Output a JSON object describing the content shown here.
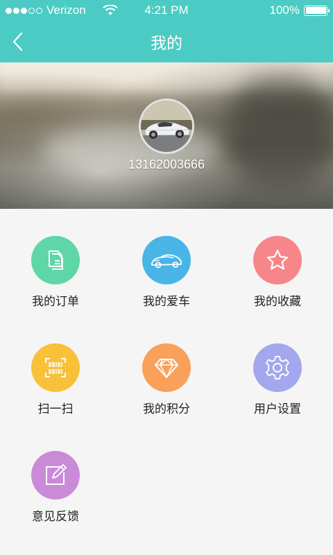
{
  "status_bar": {
    "carrier": "Verizon",
    "time": "4:21 PM",
    "battery": "100%",
    "battery_level": 1.0
  },
  "nav": {
    "title": "我的",
    "back_icon": "chevron-left-icon"
  },
  "profile": {
    "phone": "13162003666",
    "avatar_icon": "car-photo"
  },
  "menu": [
    {
      "label": "我的订单",
      "icon": "document-icon",
      "color": "#5ed6a8"
    },
    {
      "label": "我的爱车",
      "icon": "car-icon",
      "color": "#49b5e6"
    },
    {
      "label": "我的收藏",
      "icon": "star-icon",
      "color": "#f7868a"
    },
    {
      "label": "扫一扫",
      "icon": "barcode-scan-icon",
      "color": "#f9c13a"
    },
    {
      "label": "我的积分",
      "icon": "diamond-icon",
      "color": "#f9a05a"
    },
    {
      "label": "用户设置",
      "icon": "gear-icon",
      "color": "#a3a7ee"
    },
    {
      "label": "意见反馈",
      "icon": "edit-icon",
      "color": "#c98ad8"
    }
  ]
}
